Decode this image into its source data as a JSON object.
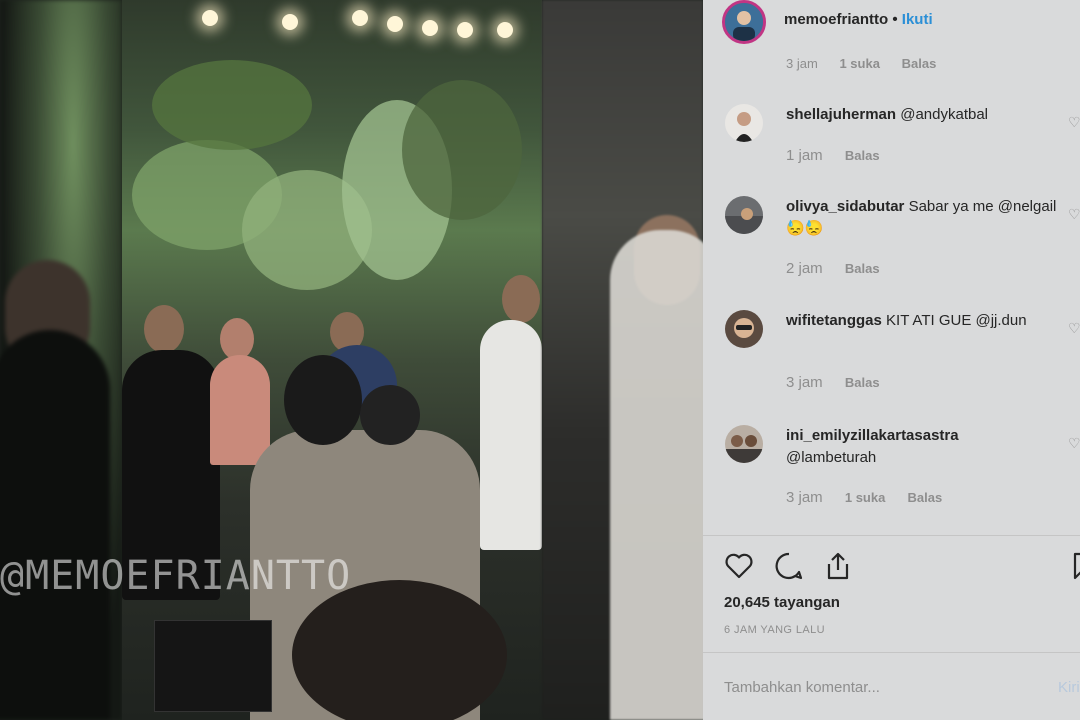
{
  "post": {
    "username": "memoefriantto",
    "separator": "•",
    "follow_label": "Ikuti",
    "watermark": "@MEMOEFRIANTTO"
  },
  "comments_cutoff": {
    "time": "3 jam",
    "likes": "1 suka",
    "reply": "Balas"
  },
  "comments": [
    {
      "user": "shellajuherman",
      "text": "@andykatbal",
      "time": "1 jam",
      "likes": "",
      "reply": "Balas"
    },
    {
      "user": "olivya_sidabutar",
      "text": "Sabar ya me @nelgail 😓😓",
      "time": "2 jam",
      "likes": "",
      "reply": "Balas"
    },
    {
      "user": "wifitetanggas",
      "text": "KIT ATI GUE @jj.dun",
      "time": "3 jam",
      "likes": "",
      "reply": "Balas"
    },
    {
      "user": "ini_emilyzillakartasastra",
      "text": "@lambeturah",
      "time": "3 jam",
      "likes": "1 suka",
      "reply": "Balas"
    }
  ],
  "actions": {
    "views": "20,645 tayangan",
    "posted": "6 JAM YANG LALU"
  },
  "composer": {
    "placeholder": "Tambahkan komentar...",
    "post_label": "Kirim"
  },
  "colors": {
    "panel_bg": "#d9dadb",
    "follow": "#2b8fd6",
    "story_ring": "#c13584"
  }
}
